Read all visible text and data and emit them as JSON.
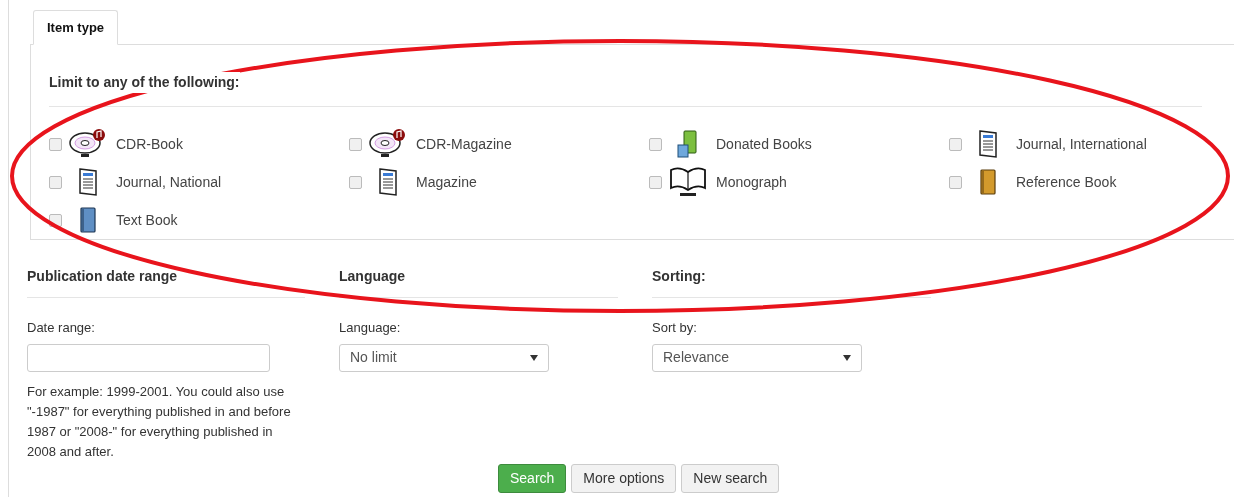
{
  "tabs": [
    {
      "label": "Item type",
      "selected": true
    }
  ],
  "item_type": {
    "heading": "Limit to any of the following:",
    "items": [
      {
        "label": "CDR-Book",
        "kind": "cd",
        "checked": false
      },
      {
        "label": "CDR-Magazine",
        "kind": "cd",
        "checked": false
      },
      {
        "label": "Donated Books",
        "kind": "donated",
        "checked": false
      },
      {
        "label": "Journal, International",
        "kind": "journal",
        "checked": false
      },
      {
        "label": "Journal, National",
        "kind": "journal",
        "checked": false
      },
      {
        "label": "Magazine",
        "kind": "journal",
        "checked": false
      },
      {
        "label": "Monograph",
        "kind": "openbook",
        "checked": false
      },
      {
        "label": "Reference Book",
        "kind": "refbook",
        "checked": false
      },
      {
        "label": "Text Book",
        "kind": "textbook",
        "checked": false
      }
    ]
  },
  "publication_date": {
    "heading": "Publication date range",
    "label": "Date range:",
    "help": "For example: 1999-2001. You could also use \"-1987\" for everything published in and before 1987 or \"2008-\" for everything published in 2008 and after."
  },
  "language": {
    "heading": "Language",
    "label": "Language:",
    "value": "No limit"
  },
  "sorting": {
    "heading": "Sorting:",
    "label": "Sort by:",
    "value": "Relevance"
  },
  "buttons": [
    {
      "label": "Search",
      "kind": "primary"
    },
    {
      "label": "More options",
      "kind": "default"
    },
    {
      "label": "New search",
      "kind": "default"
    }
  ],
  "annotation": {
    "kind": "ellipse",
    "color": "#e8141c"
  }
}
